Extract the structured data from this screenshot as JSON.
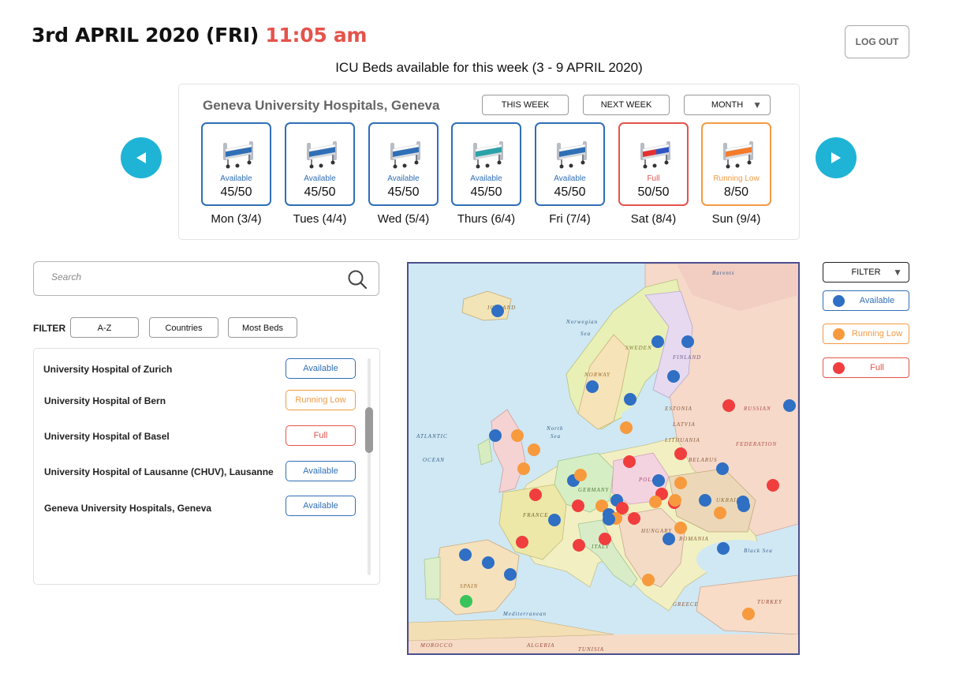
{
  "header": {
    "date": "3rd APRIL 2020 (FRI)",
    "time": "11:05 am",
    "logout_label": "LOG OUT"
  },
  "week": {
    "title": "ICU Beds available for this week (3 - 9 APRIL 2020)",
    "hospital": "Geneva University Hospitals, Geneva",
    "buttons": {
      "this_week": "THIS WEEK",
      "next_week": "NEXT WEEK",
      "month": "MONTH"
    },
    "days": [
      {
        "label": "Mon (3/4)",
        "status": "Available",
        "count": "45/50"
      },
      {
        "label": "Tues (4/4)",
        "status": "Available",
        "count": "45/50"
      },
      {
        "label": "Wed (5/4)",
        "status": "Available",
        "count": "45/50"
      },
      {
        "label": "Thurs (6/4)",
        "status": "Available",
        "count": "45/50"
      },
      {
        "label": "Fri (7/4)",
        "status": "Available",
        "count": "45/50"
      },
      {
        "label": "Sat (8/4)",
        "status": "Full",
        "count": "50/50"
      },
      {
        "label": "Sun (9/4)",
        "status": "Running Low",
        "count": "8/50"
      }
    ]
  },
  "search": {
    "placeholder": "Search"
  },
  "filters": {
    "label": "FILTER",
    "az": "A-Z",
    "countries": "Countries",
    "most_beds": "Most Beds"
  },
  "hospitals": [
    {
      "name": "University Hospital of Zurich",
      "status": "Available"
    },
    {
      "name": "University Hospital of Bern",
      "status": "Running Low"
    },
    {
      "name": "University Hospital of Basel",
      "status": "Full"
    },
    {
      "name": "University Hospital of Lausanne (CHUV), Lausanne",
      "status": "Available"
    },
    {
      "name": "Geneva University Hospitals, Geneva",
      "status": "Available"
    }
  ],
  "map": {
    "labels": {
      "atlantic": "ATLANTIC",
      "ocean": "OCEAN",
      "norwegian_sea": "Norwegian",
      "sea": "Sea",
      "north_sea": "North",
      "north_sea_2": "Sea",
      "black_sea": "Black Sea",
      "mediterranean": "Mediterranean",
      "russian": "RUSSIAN",
      "federation": "FEDERATION",
      "finland": "FINLAND",
      "sweden": "SWEDEN",
      "norway": "NORWAY",
      "france": "FRANCE",
      "spain": "SPAIN",
      "germany": "GERMANY",
      "poland": "POLAND",
      "ukraine": "UKRAINE",
      "romania": "ROMANIA",
      "turkey": "TURKEY",
      "italy": "ITALY",
      "greece": "GREECE",
      "iceland": "ICELAND",
      "barents": "Barents",
      "hungary": "HUNGARY",
      "belarus": "BELARUS",
      "latvia": "LATVIA",
      "lithuania": "LITHUANIA",
      "estonia": "ESTONIA",
      "algeria": "ALGERIA",
      "tunisia": "TUNISIA",
      "morocco": "MOROCCO"
    },
    "pins": [
      "available",
      "available",
      "available",
      "available",
      "available",
      "available",
      "running-low",
      "full",
      "available",
      "running-low",
      "full",
      "running-low",
      "available",
      "running-low",
      "full",
      "available",
      "available",
      "available",
      "full",
      "running-low",
      "full",
      "full",
      "running-low",
      "available",
      "full",
      "available",
      "available",
      "available",
      "running-low",
      "full",
      "full",
      "running-low",
      "full",
      "running-low",
      "available",
      "available",
      "running-low",
      "running-low",
      "running-low",
      "available",
      "available",
      "available",
      "available",
      "full",
      "full",
      "running-low",
      "running-low",
      "available",
      "full",
      "available",
      "green"
    ],
    "colors": {
      "available": "#2f6fc4",
      "running-low": "#f79a3e",
      "full": "#f03e3e",
      "green": "#39c45b"
    }
  },
  "legend": {
    "filter_label": "FILTER",
    "available": "Available",
    "running_low": "Running Low",
    "full": "Full",
    "colors": {
      "available": "#2f6fc4",
      "running_low": "#f79a3e",
      "full": "#f03e3e"
    }
  }
}
